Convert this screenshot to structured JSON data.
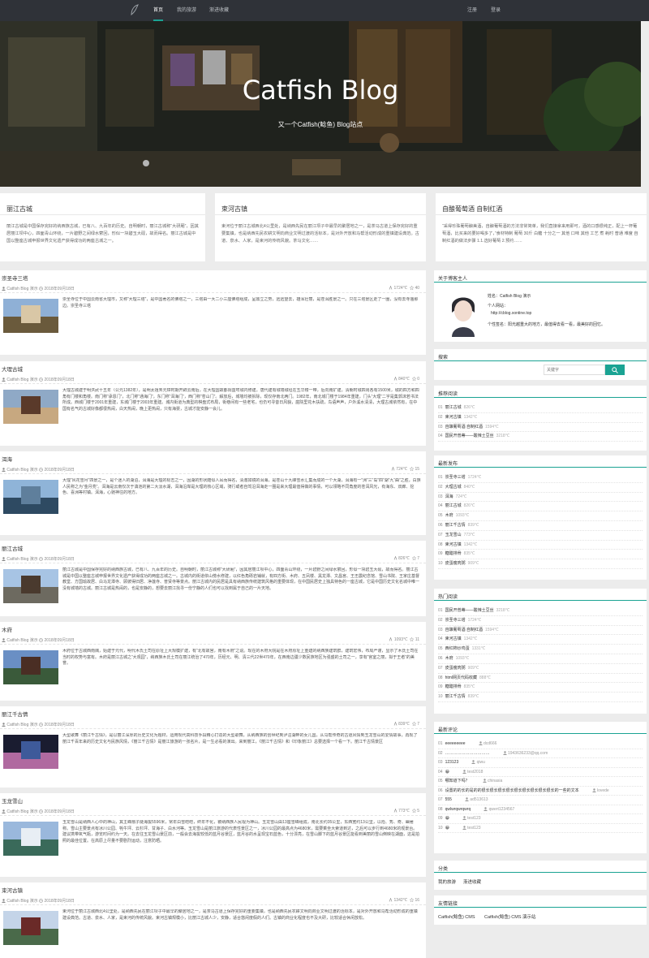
{
  "nav": {
    "items": [
      "首页",
      "我的旅游",
      "渐进收藏"
    ],
    "active": 0,
    "register": "注册",
    "login": "登录"
  },
  "hero": {
    "title": "Catfish Blog",
    "subtitle": "又一个Catfish(鲶鱼) Blog站点"
  },
  "featured": [
    {
      "title": "丽江古城",
      "desc": "丽江古城是中国保存完好的纳西族古城，已有八、九百年的历史。自明朝时，丽江古城称“大研厢”，因其居丽江坝中心，四面青山环绕，一片碧野之间绿水萦回，形似一块碧玉大砚，故而得名。丽江古城是中国以整座古城申报世界文化遗产获得成功的两座古城之一。"
    },
    {
      "title": "束河古镇",
      "desc": "束河位于丽江古城西北4公里处，是纳西先民在丽江坝子中最早的聚居地之一，是茶马古道上保存完好的重要集镇，也是纳西先民农耕文明向商业文明过渡的活标本，是对外开放和马帮活动形成的重镇建设典范。古道、泉水、人家，是束河的传统风貌。茶马文化……"
    },
    {
      "title": "自酿葡萄酒 自制红酒",
      "desc": "“采得珍珠葡萄酿美酒，自酿葡萄酒的方法非常简单，我们直接拿来用即可，酒的口感很纯正，配上一杯葡萄酒，比买来的要好喝多了，”食材特制 葡萄 30斤 白糖 十分之一 其他 口味 其他 工艺 煮 耗时 普通 难度 自制红酒的做法步骤 1.1.选好葡萄 2.预约……"
    }
  ],
  "posts": [
    {
      "title": "崇圣寺三塔",
      "author": "Catfish Blog 演示",
      "date": "2018年09月18日",
      "views": "1724℃",
      "likes": "40",
      "excerpt": "崇圣寺位于中国云南省大理市，又称“大理三塔”，是中国著名的佛塔之一，三塔由一大二小三座佛塔组成，呈鼎立之势，远远望去，雄浑壮丽，是苍洱胜景之一。只在三塔景区走了一圈，没有去寺庙那边。崇圣寺三塔"
    },
    {
      "title": "大理古城",
      "author": "Catfish Blog 演示",
      "date": "2018年09月18日",
      "views": "840℃",
      "likes": "0",
      "excerpt": "大理古城建于明洪武十五年（公元1382年），是明太祖朱元璋时期开辟云南后，在大理国故都阳苴咩城内修建。唐代建有城墙城垣在五华楼一带，后向南扩建。清朝时城四周各有1500米，城的四方和四角有门楼和角楼。南门称“承恩门”，北门称“通海门”，东门称“洱海门”，西门称“苍山门”。解放后，城墙均被拆除，现仅存南北两门。1982年，南北城门楼于1984年重建，门头“大理”二字是集郭沫若书法所成。西城门楼于2001年重建，东城门楼于2003年重建。城内街道为典型的棋盘式布局，街巷间有一些老宅，也仍可寻昔日风貌，庭院里花木扶疏，鸟语声声，户外溪水清清，大理古城依然有，在中国有名气的古城好像都很热闹，白天热闹，晚上更热闹，只有海晏，古城才能安静一会儿。"
    },
    {
      "title": "洱海",
      "author": "Catfish Blog 演示",
      "date": "2018年09月18日",
      "views": "724℃",
      "likes": "15",
      "excerpt": "大理“风花雪月”四景之一，是个迷人的湖泊，洱海是大理的标志之一，因湖的形状酷似人耳而得名，清澈如镜的洱海，是苍山十九峰雪水汇集而成的一个大湖，洱海有一“洲”三“岛”四“湖”九“曲”之胜，白族人民称之为“金月亮”。洱海是云南仅次于滇池的第二大淡水湖，洱海沿岸是大理的核心区域，骑行或者自驾沿洱海走一圈是来大理最值得做的事情，可以领略不同角度的苍洱风光，有海东、双廊、挖色、喜洲等村镇。洱海，心驰神往的地方。"
    },
    {
      "title": "丽江古城",
      "author": "Catfish Blog 演示",
      "date": "2018年09月18日",
      "views": "826℃",
      "likes": "7",
      "excerpt": "丽江古城是中国保存完好的纳西族古城，已有八、九百年的历史。自明朝时，丽江古城称“大研厢”，因其居丽江坝中心，四面青山环绕，一片碧野之间绿水萦回，形似一块碧玉大砚，故而得名。丽江古城是中国以整座古城申报世界文化遗产获得成功的两座古城之一。古城内的街道依山傍水修建，以红色角砾岩铺就，有四方街、木府、五凤楼、黑龙潭、文昌宫、王丕震纪念馆、雪山书院、王家庄基督教堂、方国瑜故居、白马龙潭寺、顾彼得旧居、净莲寺、普贤寺等景点。丽江古城内的民居是具有纳西族传统建筑风格的重要体现，在中国民居史上独具特色的一座古城，它是中国历史文化名城中唯一没有城墙的古城。丽江古城是热闹的，也是安静的，想要去丽江找寻一份宁静的人们也可以找到属于自己的一片天地。"
    },
    {
      "title": "木府",
      "author": "Catfish Blog 演示",
      "date": "2018年09月18日",
      "views": "1093℃",
      "likes": "11",
      "excerpt": "木府位于古城西南隅，始建于元代，明代木氏土司在原址上大规模扩建，有“北有故宫，南有木府”之说。现在的木府大院是在木府原址上重建的纳西族建筑群，建筑宏伟，布局严谨，显示了木氏土司在当时的权势与富有。木府是丽江古城之“大观园”，纳西族木氏土司在丽江统治了470年，历经元、明、清三代22世470年，在西南边疆少数民族地区为强盛的土司之一，享有“宫室之丽，拟于王者”的美誉。"
    },
    {
      "title": "丽江千古情",
      "author": "Catfish Blog 演示",
      "date": "2018年09月18日",
      "views": "839℃",
      "likes": "7",
      "excerpt": "大型歌舞《丽江千古情》，是以丽江深厚的历史文化为题材，运用现代高科技手段精心打造的大型歌舞，从纳西族的创世纪到泸沽湖畔的女儿国，从马帮传奇的古道风情到玉龙雪山的爱情故事，再现了丽江千百年来的历史文化与民族风情，《丽江千古情》是丽江旅游的一张名片，是一生必看的演出。来到丽江，《丽江千古情》和《印象丽江》总要选择一个看一下。丽江千古情景区"
    },
    {
      "title": "玉龙雪山",
      "author": "Catfish Blog 演示",
      "date": "2018年09月18日",
      "views": "773℃",
      "likes": "5",
      "excerpt": "玉龙雪山是纳西人心中的神山，其主峰扇子陡海拔5596米，常年白雪皑皑，终年不化，被纳西族人民视为神山。玉龙雪山由13座雪峰组成，南北长约35公里，东西宽约13公里，以险、秀、奇、幽著称。雪山主要景点有冰川公园、牦牛坪、云杉坪、甘海子、白水河等。玉龙雪山是丽江旅游的代表性景区之一，冰川公园的最高点为4680米，需要乘坐大索道到达，之后可以步行到4680米的观景台。建议携带氧气瓶，游览时间约为一天。在去往玉龙雪山景区前，一般会去海拔较低的蓝月谷景区，蓝月谷的水呈现宝石蓝色，十分漂亮，在雪山脚下的蓝月谷景区能看到美丽的雪山倒映在湖面，这是拍照的最佳位置。在高原上尽量不要剧烈运动，注意防晒。"
    },
    {
      "title": "束河古镇",
      "author": "Catfish Blog 演示",
      "date": "2018年09月18日",
      "views": "1342℃",
      "likes": "16",
      "excerpt": "束河位于丽江古城西北4公里处，是纳西先民在丽江坝子中最早的聚居地之一，是茶马古道上保存完好的重要集镇，也是纳西先民农耕文明向商业文明过渡的活标本，是对外开放和马帮活动形成的重镇建设典范。古道、泉水、人家，是束河的传统风貌。束河古镇规模小，比丽江古城人少，安静，适合悠闲度假的人们。古镇的商业化程度也不及大研，比较适合休闲放松。"
    }
  ],
  "sidebar": {
    "about": {
      "title": "关于博客主人",
      "name": "姓名：Catfish Blog 演示",
      "site_label": "个人网站：",
      "site": "http://cblog.xontine.top",
      "sign": "个性签名：阳光越重大的地方，最值得去看一看，最美好的回忆。"
    },
    "search": {
      "title": "搜索",
      "placeholder": "关键字"
    },
    "recommend": {
      "title": "推荐阅读",
      "items": [
        {
          "t": "丽江古城",
          "v": "826℃"
        },
        {
          "t": "束河古镇",
          "v": "1342℃"
        },
        {
          "t": "自酿葡萄酒 自制红酒",
          "v": "1594℃"
        },
        {
          "t": "国民开普蒂——酸辣土豆丝",
          "v": "3218℃"
        }
      ]
    },
    "latest": {
      "title": "最新发布",
      "items": [
        {
          "t": "崇圣寺三塔",
          "v": "1724℃"
        },
        {
          "t": "大理古城",
          "v": "840℃"
        },
        {
          "t": "洱海",
          "v": "724℃"
        },
        {
          "t": "丽江古城",
          "v": "826℃"
        },
        {
          "t": "木府",
          "v": "1093℃"
        },
        {
          "t": "丽江千古情",
          "v": "839℃"
        },
        {
          "t": "玉龙雪山",
          "v": "773℃"
        },
        {
          "t": "束河古镇",
          "v": "1342℃"
        },
        {
          "t": "糖醋排骨",
          "v": "835℃"
        },
        {
          "t": "皮蛋瘦肉粥",
          "v": "909℃"
        }
      ]
    },
    "hot": {
      "title": "热门阅读",
      "items": [
        {
          "t": "国民开普蒂——酸辣土豆丝",
          "v": "3218℃"
        },
        {
          "t": "崇圣寺三塔",
          "v": "1724℃"
        },
        {
          "t": "自酿葡萄酒 自制红酒",
          "v": "1594℃"
        },
        {
          "t": "束河古镇",
          "v": "1342℃"
        },
        {
          "t": "西红柿炒鸡蛋",
          "v": "1331℃"
        },
        {
          "t": "木府",
          "v": "1093℃"
        },
        {
          "t": "皮蛋瘦肉粥",
          "v": "909℃"
        },
        {
          "t": "html网页代码收藏",
          "v": "888℃"
        },
        {
          "t": "糖醋排骨",
          "v": "835℃"
        },
        {
          "t": "丽江千古情",
          "v": "839℃"
        }
      ]
    },
    "comments": {
      "title": "最新评论",
      "items": [
        {
          "t": "eeeeeeeee",
          "u": "dcd666"
        },
        {
          "t": "……………………………",
          "u": "1943636233@qq.com"
        },
        {
          "t": "123123",
          "u": "qiwu"
        },
        {
          "t": "😀",
          "u": "test2018"
        },
        {
          "t": "哪知道下吗？",
          "u": "chinasia"
        },
        {
          "t": "设置的的长的是的的很长很长很长很长很长很长很长很长很长的一些的文本",
          "u": "lovede"
        },
        {
          "t": "555",
          "u": "ad513613"
        },
        {
          "t": "qwlwrqwrqwrq",
          "u": "qwert1234567"
        },
        {
          "t": "😀",
          "u": "test123"
        },
        {
          "t": "😀",
          "u": "test123"
        }
      ]
    },
    "category": {
      "title": "分类",
      "items": [
        "我的旅游",
        "渐进收藏"
      ]
    },
    "links": {
      "title": "友情链接",
      "items": [
        "Catfish(鲶鱼) CMS",
        "Catfish(鲶鱼) CMS 演示站"
      ]
    }
  }
}
